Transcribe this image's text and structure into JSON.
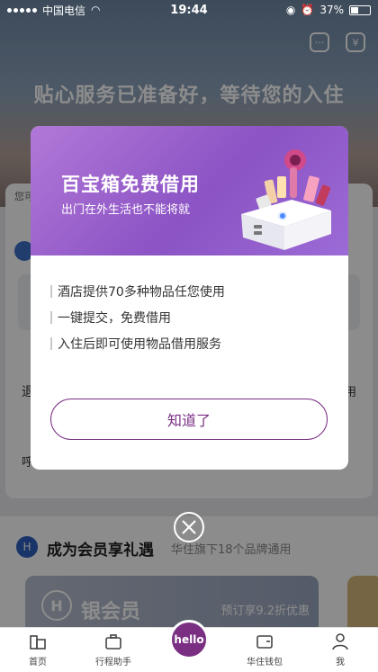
{
  "status_bar": {
    "carrier": "中国电信",
    "time": "19:44",
    "battery": "37%"
  },
  "hero": {
    "title": "贴心服务已准备好，等待您的入住"
  },
  "background": {
    "hint": "您可",
    "row_a": "退",
    "row_b": "呼",
    "row_c": "用",
    "member": {
      "title": "成为会员享礼遇",
      "subtitle": "华住旗下18个品牌通用",
      "card_title": "银会员",
      "card_promo": "预订享9.2折优惠"
    }
  },
  "modal": {
    "title": "百宝箱免费借用",
    "subtitle": "出门在外生活也不能将就",
    "bullets": [
      "酒店提供70多种物品任您使用",
      "一键提交，免费借用",
      "入住后即可使用物品借用服务"
    ],
    "button_label": "知道了"
  },
  "tabbar": {
    "items": [
      {
        "label": "首页",
        "icon": "building-icon"
      },
      {
        "label": "行程助手",
        "icon": "briefcase-icon"
      },
      {
        "label": "hello",
        "icon": "hello-icon"
      },
      {
        "label": "华住钱包",
        "icon": "wallet-icon"
      },
      {
        "label": "我",
        "icon": "person-icon"
      }
    ]
  },
  "colors": {
    "brand_purple": "#7a2f83",
    "modal_header": "#9c6bd6"
  }
}
